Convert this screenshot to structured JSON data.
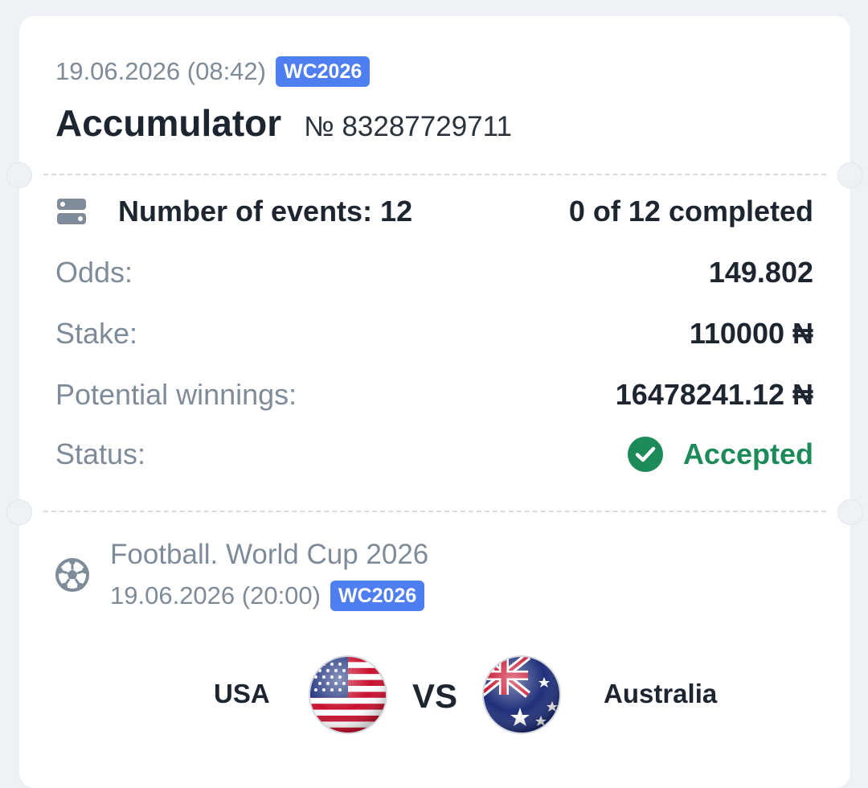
{
  "header": {
    "date": "19.06.2026 (08:42)",
    "badge": "WC2026",
    "title": "Accumulator",
    "bet_number": "№ 83287729711"
  },
  "summary": {
    "events_label": "Number of events: 12",
    "completed": "0 of 12 completed",
    "odds_label": "Odds:",
    "odds_value": "149.802",
    "stake_label": "Stake:",
    "stake_value": "110000 ₦",
    "winnings_label": "Potential winnings:",
    "winnings_value": "16478241.12 ₦",
    "status_label": "Status:",
    "status_value": "Accepted",
    "status_color": "#1d8a5a"
  },
  "event": {
    "league": "Football. World Cup 2026",
    "date": "19.06.2026 (20:00)",
    "badge": "WC2026",
    "home_team": "USA",
    "vs": "VS",
    "away_team": "Australia",
    "home_flag_icon": "usa-flag-icon",
    "away_flag_icon": "australia-flag-icon"
  },
  "colors": {
    "badge": "#4e7ef0",
    "muted_text": "#7e8b99",
    "dark_text": "#1c2530"
  }
}
